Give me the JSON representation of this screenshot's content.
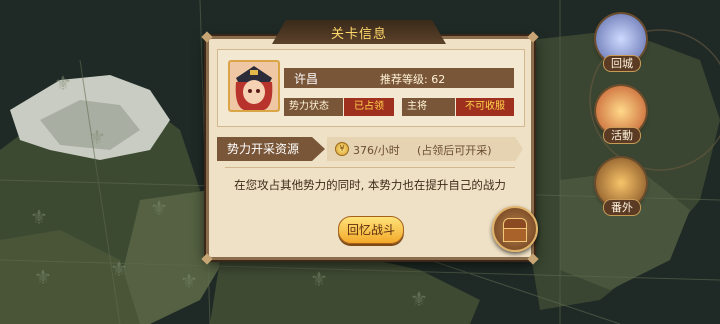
{
  "dialog": {
    "title": "关卡信息",
    "city_name": "许昌",
    "recommended_level": "推荐等级: 62",
    "faction_status_label": "势力状态",
    "faction_status_value": "已占领",
    "general_label": "主将",
    "general_value": "不可收服",
    "resource_label": "势力开采资源",
    "resource_amount": "376/小时",
    "resource_note": "(占领后可开采)",
    "description": "在您攻占其他势力的同时, 本势力也在提升自己的战力",
    "battle_button": "回忆战斗"
  },
  "side_menu": {
    "return_city": "回城",
    "recharge": "活動",
    "extra": "番外"
  },
  "colors": {
    "title_gold": "#ffd86a",
    "status_red": "#a0301e",
    "panel_bg": "#efe1c6",
    "label_brown": "#7a5638"
  },
  "icons": [
    "return-city-icon",
    "recharge-gift-icon",
    "extra-chest-icon",
    "resource-coin-icon",
    "treasure-chest-icon",
    "general-portrait",
    "faction-emblem-icon"
  ]
}
